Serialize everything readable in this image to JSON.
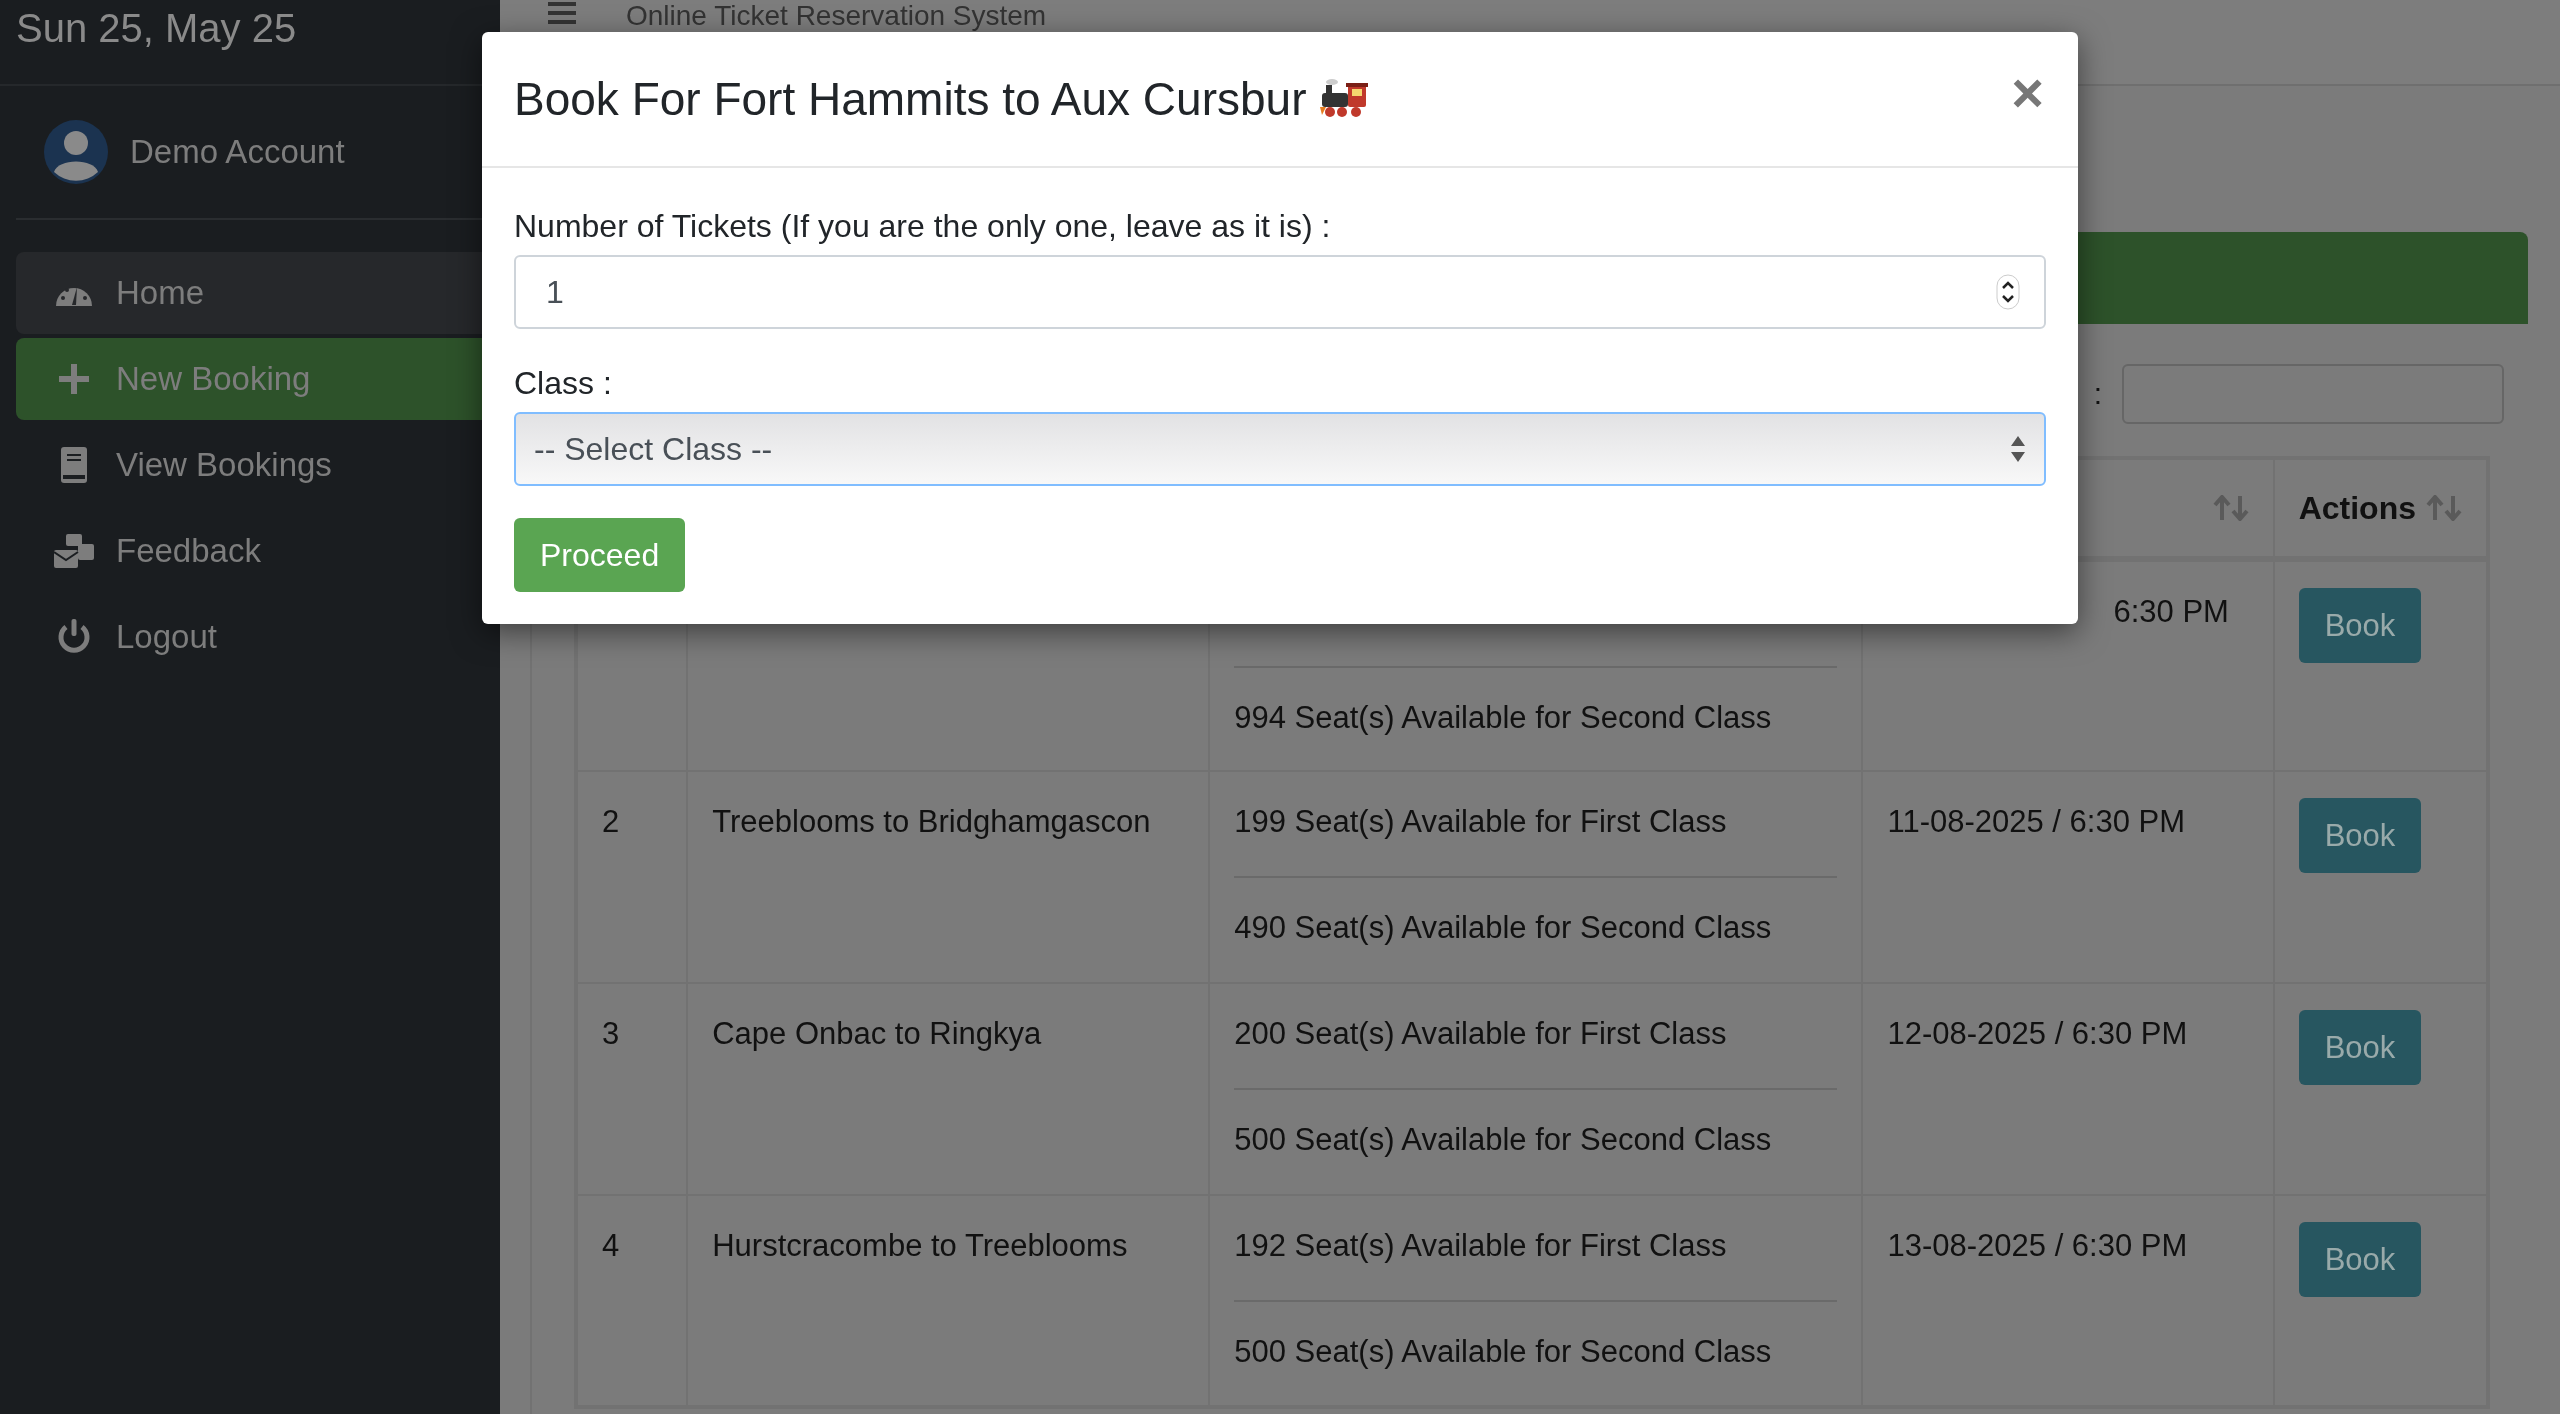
{
  "sidebar": {
    "date": "Sun 25, May 25",
    "user": "Demo Account",
    "items": [
      {
        "label": "Home",
        "kind": "dashboard",
        "selected": false
      },
      {
        "label": "New Booking",
        "kind": "plus",
        "selected": true
      },
      {
        "label": "View Bookings",
        "kind": "book",
        "selected": false
      },
      {
        "label": "Feedback",
        "kind": "mail",
        "selected": false
      },
      {
        "label": "Logout",
        "kind": "power",
        "selected": false
      }
    ]
  },
  "topbar": {
    "title": "Online Ticket Reservation System"
  },
  "search": {
    "label": ":"
  },
  "table": {
    "columns": [
      {
        "sortable": true
      },
      {
        "label": "Actions",
        "sortable": true
      }
    ],
    "rows": [
      {
        "second_class": "994 Seat(s) Available for Second Class",
        "datetime": "6:30 PM",
        "action": "Book"
      },
      {
        "number": "2",
        "route": "Treeblooms to Bridghamgascon",
        "first_class": "199 Seat(s) Available for First Class",
        "second_class": "490 Seat(s) Available for Second Class",
        "datetime": "11-08-2025 / 6:30 PM",
        "action": "Book"
      },
      {
        "number": "3",
        "route": "Cape Onbac to Ringkya",
        "first_class": "200 Seat(s) Available for First Class",
        "second_class": "500 Seat(s) Available for Second Class",
        "datetime": "12-08-2025 / 6:30 PM",
        "action": "Book"
      },
      {
        "number": "4",
        "route": "Hurstcracombe to Treeblooms",
        "first_class": "192 Seat(s) Available for First Class",
        "second_class": "500 Seat(s) Available for Second Class",
        "datetime": "13-08-2025 / 6:30 PM",
        "action": "Book"
      }
    ]
  },
  "modal": {
    "title": "Book For Fort Hammits to Aux Cursbur",
    "close": "×",
    "tickets_label": "Number of Tickets (If you are the only one, leave as it is) :",
    "tickets_value": "1",
    "class_label": "Class :",
    "class_value": "-- Select Class --",
    "submit": "Proceed"
  }
}
